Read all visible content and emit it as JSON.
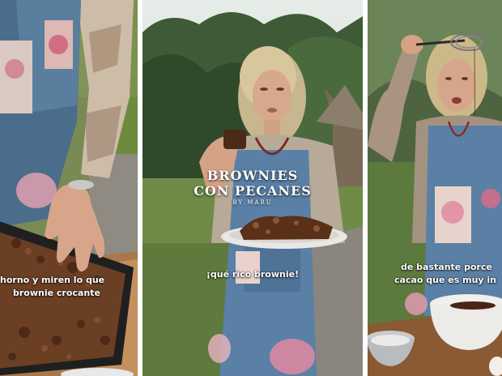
{
  "panels": [
    {
      "caption_line1": "horno y miren lo que",
      "caption_line2": "brownie crocante"
    },
    {
      "title_line1": "BROWNIES",
      "title_line2": "CON PECANES",
      "title_byline": "BY MARU",
      "caption": "¡qué rico brownie!"
    },
    {
      "caption_line1": "de bastante porce",
      "caption_line2": "cacao que es muy in"
    }
  ]
}
